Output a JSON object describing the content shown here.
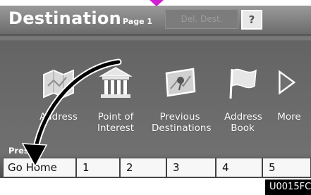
{
  "header": {
    "title": "Destination",
    "page_label": "Page 1",
    "del_dest_label": "Del. Dest.",
    "help_label": "?"
  },
  "destinations": [
    {
      "name": "address",
      "label": "Address",
      "icon": "map-icon"
    },
    {
      "name": "point-of-interest",
      "label": "Point of Interest",
      "icon": "building-icon"
    },
    {
      "name": "previous-destinations",
      "label": "Previous Destinations",
      "icon": "map-pin-icon"
    },
    {
      "name": "address-book",
      "label": "Address Book",
      "icon": "flag-icon"
    },
    {
      "name": "more",
      "label": "More",
      "icon": "triangle-right-icon"
    }
  ],
  "presets": {
    "label": "Presets",
    "buttons": [
      "Go Home",
      "1",
      "2",
      "3",
      "4",
      "5"
    ]
  },
  "code": "U0015FC",
  "colors": {
    "marker": "#d21ed2",
    "screen_bg": "#707070",
    "arrow": "#000000"
  }
}
